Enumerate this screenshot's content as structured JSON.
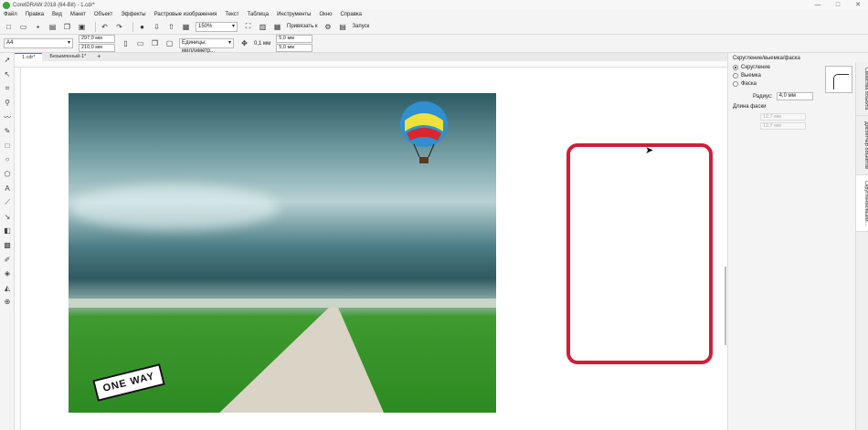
{
  "titlebar": {
    "title": "CorelDRAW 2018 (64-Bit) - 1.cdr*"
  },
  "menubar": [
    "Файл",
    "Правка",
    "Вид",
    "Макет",
    "Объект",
    "Эффекты",
    "Растровые изображения",
    "Текст",
    "Таблица",
    "Инструменты",
    "Окно",
    "Справка"
  ],
  "toolbar1": {
    "zoom": "150%",
    "snap_label": "Привязать к",
    "launch_label": "Запуск"
  },
  "toolbar2": {
    "page_size": "A4",
    "width": "297,0 мм",
    "height": "210,0 мм",
    "units": "Единицы: миллиметр...",
    "nudge": "0,1 мм",
    "dup_x": "5,0 мм",
    "dup_y": "5,0 мм"
  },
  "doctabs": [
    "1.cdr*",
    "Безымянный-1*",
    "+"
  ],
  "photo": {
    "sign_text": "ONE WAY"
  },
  "panel": {
    "title": "Скругление/выемка/фаска",
    "options": [
      "Скругление",
      "Выемка",
      "Фаска"
    ],
    "selected": "Скругление",
    "radius_label": "Радиус:",
    "radius_value": "4,0 мм",
    "chamfer_label": "Длина фаски",
    "chamfer_1": "12,7 мм",
    "chamfer_2": "12,7 мм"
  },
  "side_tabs": [
    "Свойства объекта",
    "Диспетчер объектов",
    "Скругление/выем..."
  ],
  "colors": {
    "selection": "#cf1e3a",
    "accent": "#3b7ad8"
  }
}
